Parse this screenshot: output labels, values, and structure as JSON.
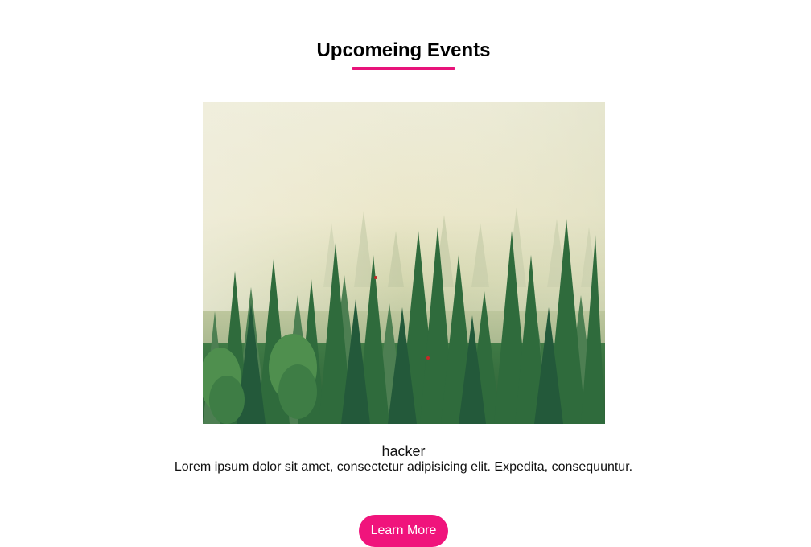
{
  "section": {
    "title": "Upcomeing Events"
  },
  "event": {
    "image_alt": "foggy pine forest",
    "name": "hacker",
    "description": "Lorem ipsum dolor sit amet, consectetur adipisicing elit. Expedita, consequuntur.",
    "button_label": "Learn More"
  },
  "colors": {
    "accent": "#e8137a",
    "button": "#f0147c"
  }
}
